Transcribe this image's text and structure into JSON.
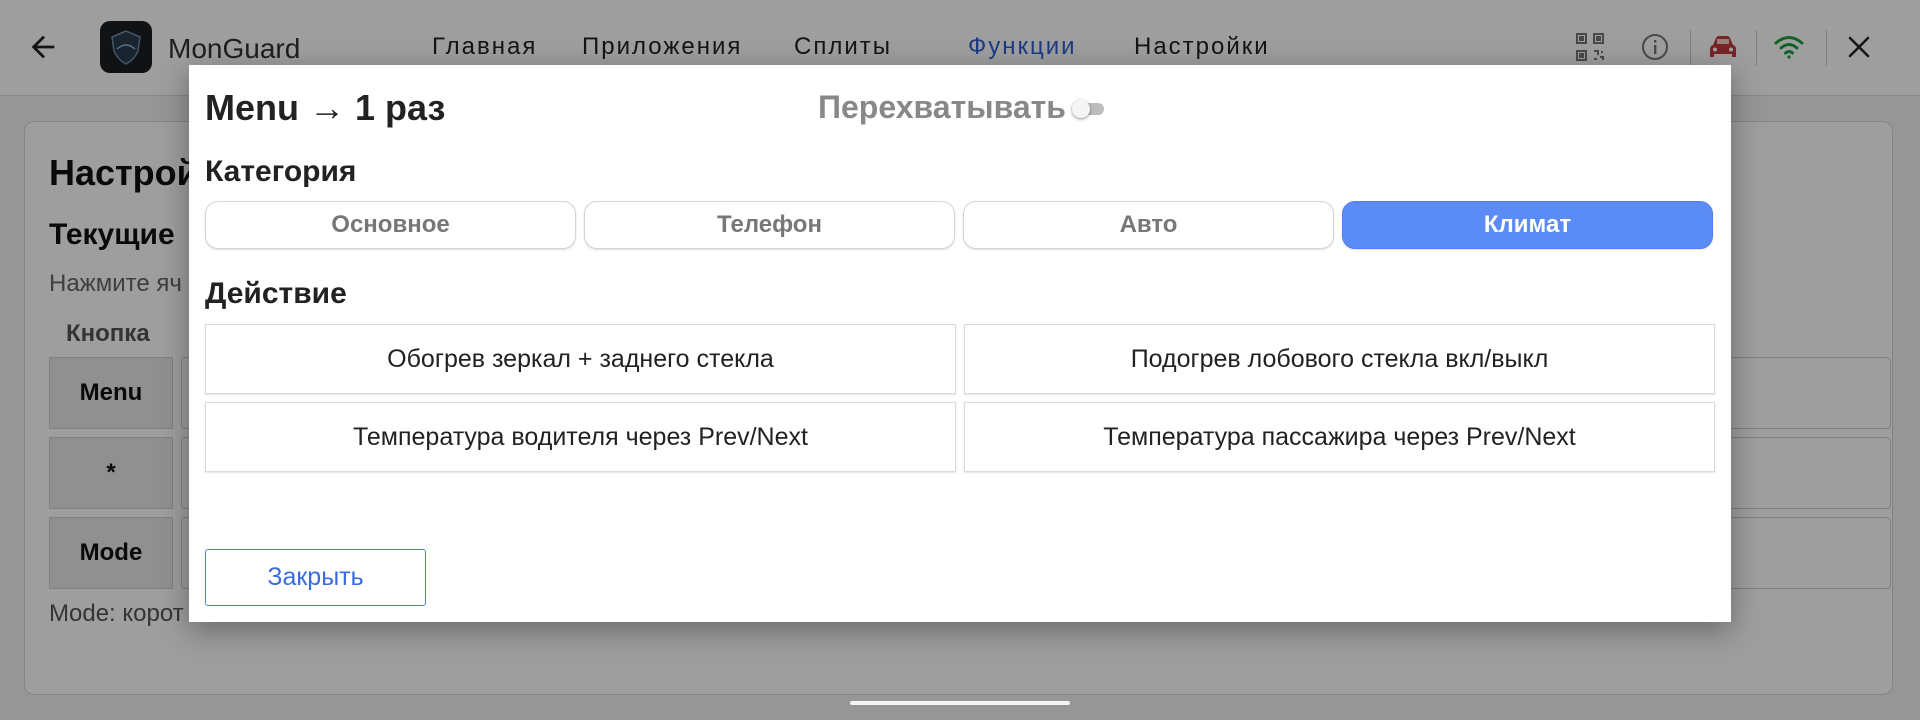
{
  "app": {
    "title": "MonGuard"
  },
  "nav": {
    "items": [
      {
        "label": "Главная"
      },
      {
        "label": "Приложения"
      },
      {
        "label": "Сплиты"
      },
      {
        "label": "Функции",
        "active": true
      },
      {
        "label": "Настройки"
      }
    ]
  },
  "toolbar_icons": [
    "back-arrow-icon",
    "qr-code-icon",
    "info-icon",
    "car-icon",
    "wifi-icon",
    "close-icon"
  ],
  "colors": {
    "accent": "#5b8cf5",
    "nav_active": "#2f5fd6",
    "car_icon": "#c23a3a",
    "wifi_icon": "#1f9d3a"
  },
  "background_page": {
    "title": "Настрой",
    "subtitle": "Текущие",
    "hint": "Нажмите яч",
    "column_header": "Кнопка",
    "keys": [
      "Menu",
      "*",
      "Mode"
    ],
    "footer": "Mode: корот"
  },
  "dialog": {
    "title": "Menu → 1 раз",
    "intercept_label": "Перехватывать",
    "intercept_enabled": false,
    "category_label": "Категория",
    "categories": [
      {
        "label": "Основное",
        "selected": false
      },
      {
        "label": "Телефон",
        "selected": false
      },
      {
        "label": "Авто",
        "selected": false
      },
      {
        "label": "Климат",
        "selected": true
      }
    ],
    "action_label": "Действие",
    "actions": [
      {
        "label": "Обогрев зеркал + заднего стекла"
      },
      {
        "label": "Подогрев лобового стекла вкл/выкл"
      },
      {
        "label": "Температура водителя через Prev/Next"
      },
      {
        "label": "Температура пассажира через Prev/Next"
      }
    ],
    "close_label": "Закрыть"
  }
}
